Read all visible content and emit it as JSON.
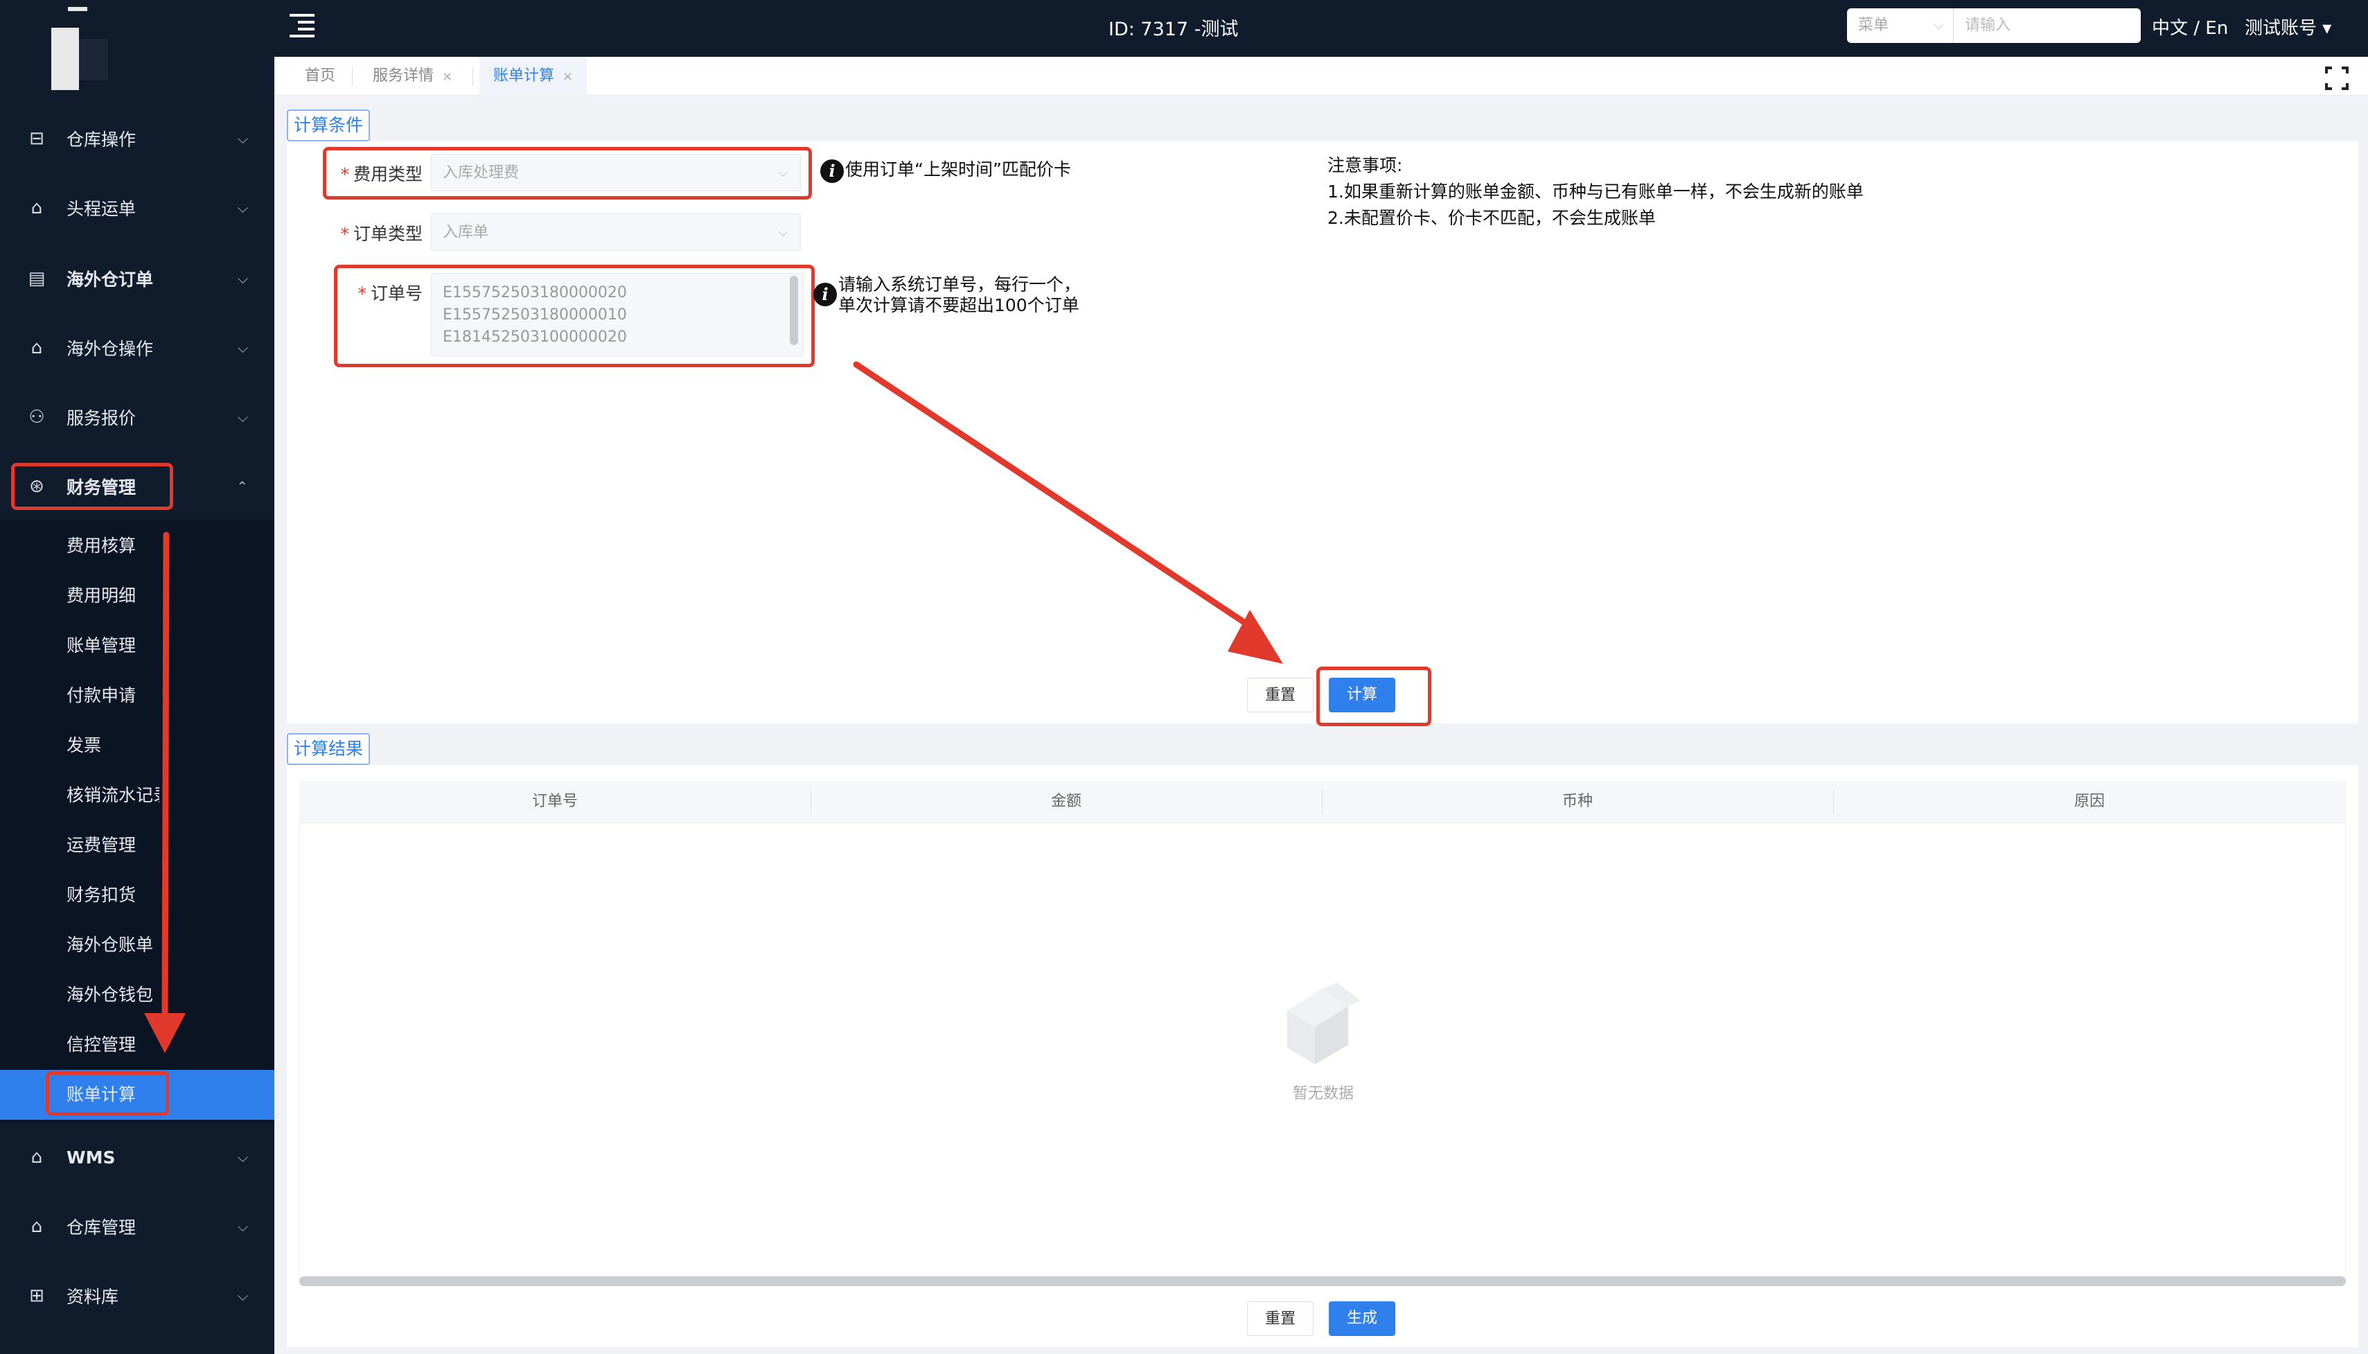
{
  "header": {
    "title": "ID: 7317 -测试",
    "search_type": "菜单",
    "search_placeholder": "请输入",
    "lang": "中文 / En",
    "account": "测试账号 ▾"
  },
  "sidebar": {
    "items": [
      {
        "label": "仓库操作",
        "icon": "warehouse-icon"
      },
      {
        "label": "头程运单",
        "icon": "shipment-icon"
      },
      {
        "label": "海外仓订单",
        "icon": "order-icon"
      },
      {
        "label": "海外仓操作",
        "icon": "operation-icon"
      },
      {
        "label": "服务报价",
        "icon": "quote-icon"
      },
      {
        "label": "财务管理",
        "icon": "finance-icon"
      },
      {
        "label": "WMS",
        "icon": "wms-icon"
      },
      {
        "label": "仓库管理",
        "icon": "warehouse-manage-icon"
      },
      {
        "label": "资料库",
        "icon": "database-icon"
      }
    ],
    "finance_sub": [
      "费用核算",
      "费用明细",
      "账单管理",
      "付款申请",
      "发票",
      "核销流水记录",
      "运费管理",
      "财务扣货",
      "海外仓账单",
      "海外仓钱包",
      "信控管理",
      "账单计算"
    ]
  },
  "tabs": [
    {
      "label": "首页"
    },
    {
      "label": "服务详情",
      "close": "×"
    },
    {
      "label": "账单计算",
      "close": "×"
    }
  ],
  "form": {
    "section": "计算条件",
    "fee_type_label": "费用类型",
    "fee_type_value": "入库处理费",
    "fee_hint": "使用订单“上架时间”匹配价卡",
    "order_type_label": "订单类型",
    "order_type_value": "入库单",
    "order_no_label": "订单号",
    "order_nos": [
      "E155752503180000020",
      "E155752503180000010",
      "E181452503100000020"
    ],
    "order_hint_1": "请输入系统订单号，每行一个，",
    "order_hint_2": "单次计算请不要超出100个订单",
    "notes_title": "注意事项:",
    "note_1": "1.如果重新计算的账单金额、币种与已有账单一样，不会生成新的账单",
    "note_2": "2.未配置价卡、价卡不匹配，不会生成账单",
    "reset": "重置",
    "calculate": "计算",
    "required_mark": "*"
  },
  "result": {
    "section": "计算结果",
    "columns": [
      "订单号",
      "金额",
      "币种",
      "原因"
    ],
    "empty": "暂无数据",
    "reset": "重置",
    "generate": "生成"
  },
  "colors": {
    "sidebar_bg": "#101b2c",
    "accent": "#2f80ed",
    "highlight_red": "#e13a2c"
  }
}
